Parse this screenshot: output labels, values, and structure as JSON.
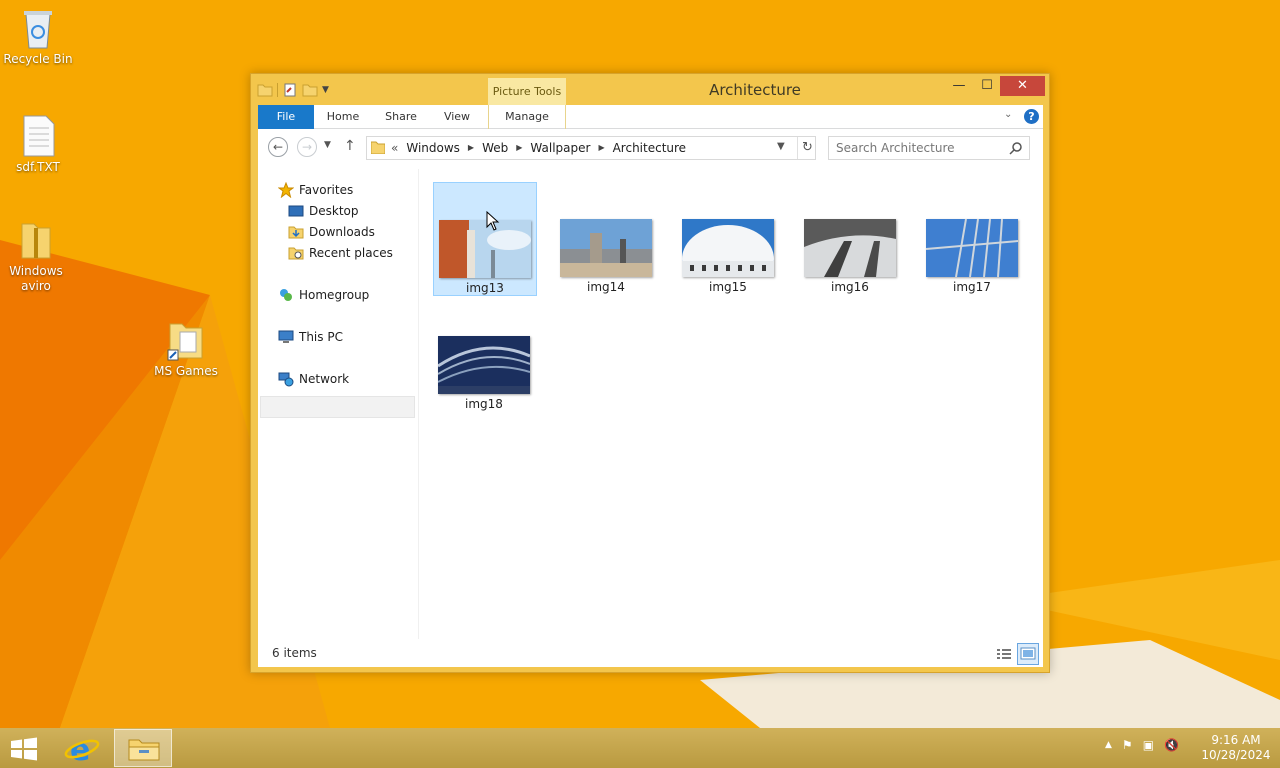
{
  "desktop": {
    "icons": [
      {
        "label": "Recycle Bin"
      },
      {
        "label": "sdf.TXT"
      },
      {
        "label": "Windows aviro"
      },
      {
        "label": "MS Games"
      }
    ]
  },
  "window": {
    "title": "Architecture",
    "context_tab": "Picture Tools",
    "tabs": {
      "file": "File",
      "home": "Home",
      "share": "Share",
      "view": "View",
      "manage": "Manage"
    },
    "help": "?",
    "address": {
      "overflow": "«",
      "crumbs": [
        "Windows",
        "Web",
        "Wallpaper",
        "Architecture"
      ]
    },
    "search": {
      "placeholder": "Search Architecture"
    },
    "nav": {
      "favorites": "Favorites",
      "desktop": "Desktop",
      "downloads": "Downloads",
      "recent": "Recent places",
      "homegroup": "Homegroup",
      "thispc": "This PC",
      "network": "Network"
    },
    "files": [
      {
        "name": "img13",
        "selected": true
      },
      {
        "name": "img14"
      },
      {
        "name": "img15"
      },
      {
        "name": "img16"
      },
      {
        "name": "img17"
      },
      {
        "name": "img18"
      }
    ],
    "status": "6 items"
  },
  "taskbar": {
    "time": "9:16 AM",
    "date": "10/28/2024"
  },
  "colors": {
    "desktop": "#f6a100",
    "window_frame": "#f3c64c",
    "file_tab": "#1979ca",
    "selection": "#cce8ff",
    "close_button": "#c7473b"
  }
}
